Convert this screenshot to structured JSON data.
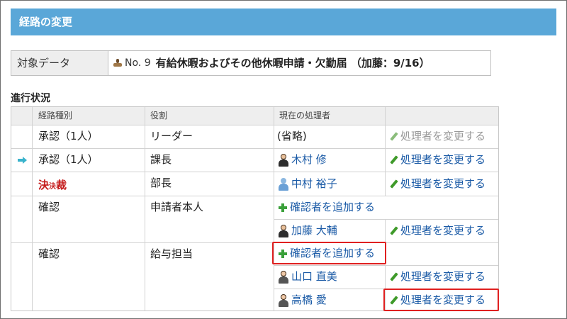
{
  "header": {
    "title": "経路の変更"
  },
  "target": {
    "label": "対象データ",
    "number": "No. 9",
    "subject": "有給休暇およびその他休暇申請・欠勤届 （加藤：9/16）"
  },
  "progress": {
    "title": "進行状況",
    "columns": [
      "経路種別",
      "役割",
      "現在の処理者",
      ""
    ],
    "rows": [
      {
        "type": "承認（1人）",
        "role": "リーダー",
        "handler": "(省略)",
        "action": "処理者を変更する"
      },
      {
        "type": "承認（1人）",
        "role": "課長",
        "handler": "木村 修",
        "action": "処理者を変更する"
      },
      {
        "type": "決裁",
        "role": "部長",
        "handler": "中村 裕子",
        "action": "処理者を変更する"
      },
      {
        "type": "確認",
        "role": "申請者本人",
        "add_action": "確認者を追加する",
        "handler": "加藤 大輔",
        "action": "処理者を変更する"
      },
      {
        "type": "確認",
        "role": "給与担当",
        "add_action": "確認者を追加する",
        "handlers": [
          {
            "name": "山口 直美",
            "action": "処理者を変更する"
          },
          {
            "name": "高橋 愛",
            "action": "処理者を変更する"
          }
        ]
      }
    ]
  },
  "ketsusai_stamp": {
    "char1": "決",
    "char2": "裁",
    "mid": "決"
  },
  "colors": {
    "title_bar": "#5aa7d8",
    "link": "#1a5aa6",
    "highlight": "#e02020",
    "current_arrow": "#39b3cc"
  },
  "icons": [
    "stamp-icon",
    "arrow-right-icon",
    "pencil-icon",
    "plus-icon",
    "user-avatar-icon"
  ]
}
